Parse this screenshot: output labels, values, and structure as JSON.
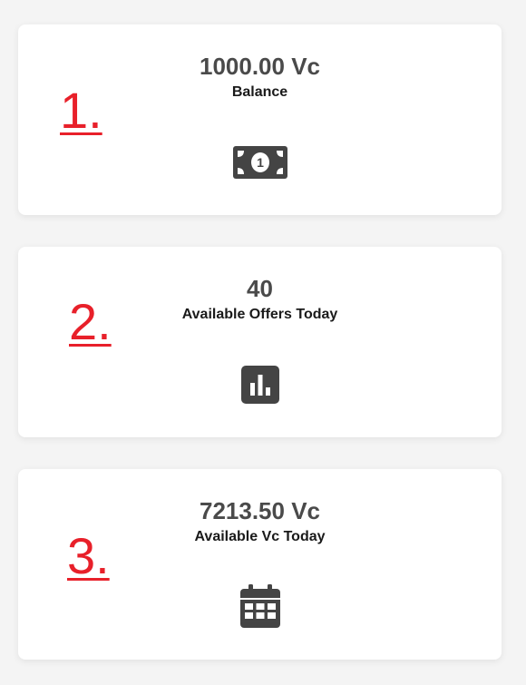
{
  "cards": [
    {
      "value": "1000.00 Vc",
      "label": "Balance",
      "icon": "money-bill-icon",
      "annotation": "1."
    },
    {
      "value": "40",
      "label": "Available Offers Today",
      "icon": "bar-chart-icon",
      "annotation": "2."
    },
    {
      "value": "7213.50 Vc",
      "label": "Available Vc Today",
      "icon": "calendar-icon",
      "annotation": "3."
    }
  ],
  "colors": {
    "value_text": "#4a4a4a",
    "label_text": "#1a1a1a",
    "icon": "#444444",
    "annotation": "#e8202a",
    "background": "#f4f4f4",
    "card": "#ffffff"
  }
}
